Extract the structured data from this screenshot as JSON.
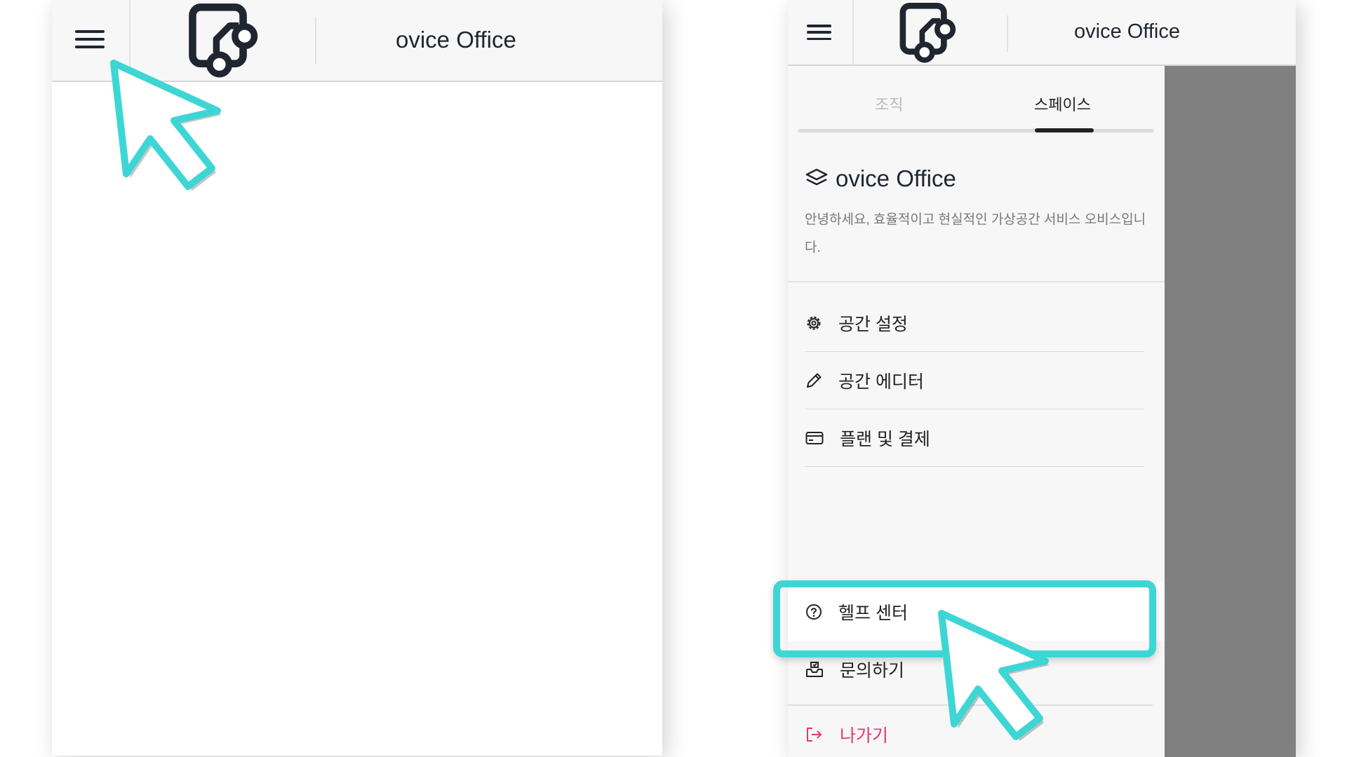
{
  "left_panel": {
    "header": {
      "title": "ovice Office"
    }
  },
  "right_panel": {
    "header": {
      "title": "ovice Office"
    },
    "tabs": [
      {
        "label": "조직",
        "active": false
      },
      {
        "label": "스페이스",
        "active": true
      }
    ],
    "space": {
      "name": "ovice Office",
      "description": "안녕하세요, 효율적이고 현실적인 가상공간 서비스 오비스입니다."
    },
    "menu": [
      {
        "label": "공간 설정",
        "icon": "gear-icon"
      },
      {
        "label": "공간 에디터",
        "icon": "pencil-icon"
      },
      {
        "label": "플랜 및 결제",
        "icon": "credit-card-icon"
      }
    ],
    "bottom_menu": [
      {
        "label": "헬프 센터",
        "icon": "question-circle-icon"
      },
      {
        "label": "문의하기",
        "icon": "inbox-icon"
      },
      {
        "label": "나가기",
        "icon": "logout-icon"
      }
    ]
  },
  "colors": {
    "highlight": "#3ed6d5",
    "exit": "#e5386f",
    "overlay": "#808080",
    "header_bg": "#f7f7f8",
    "logo": "#1f2630"
  }
}
